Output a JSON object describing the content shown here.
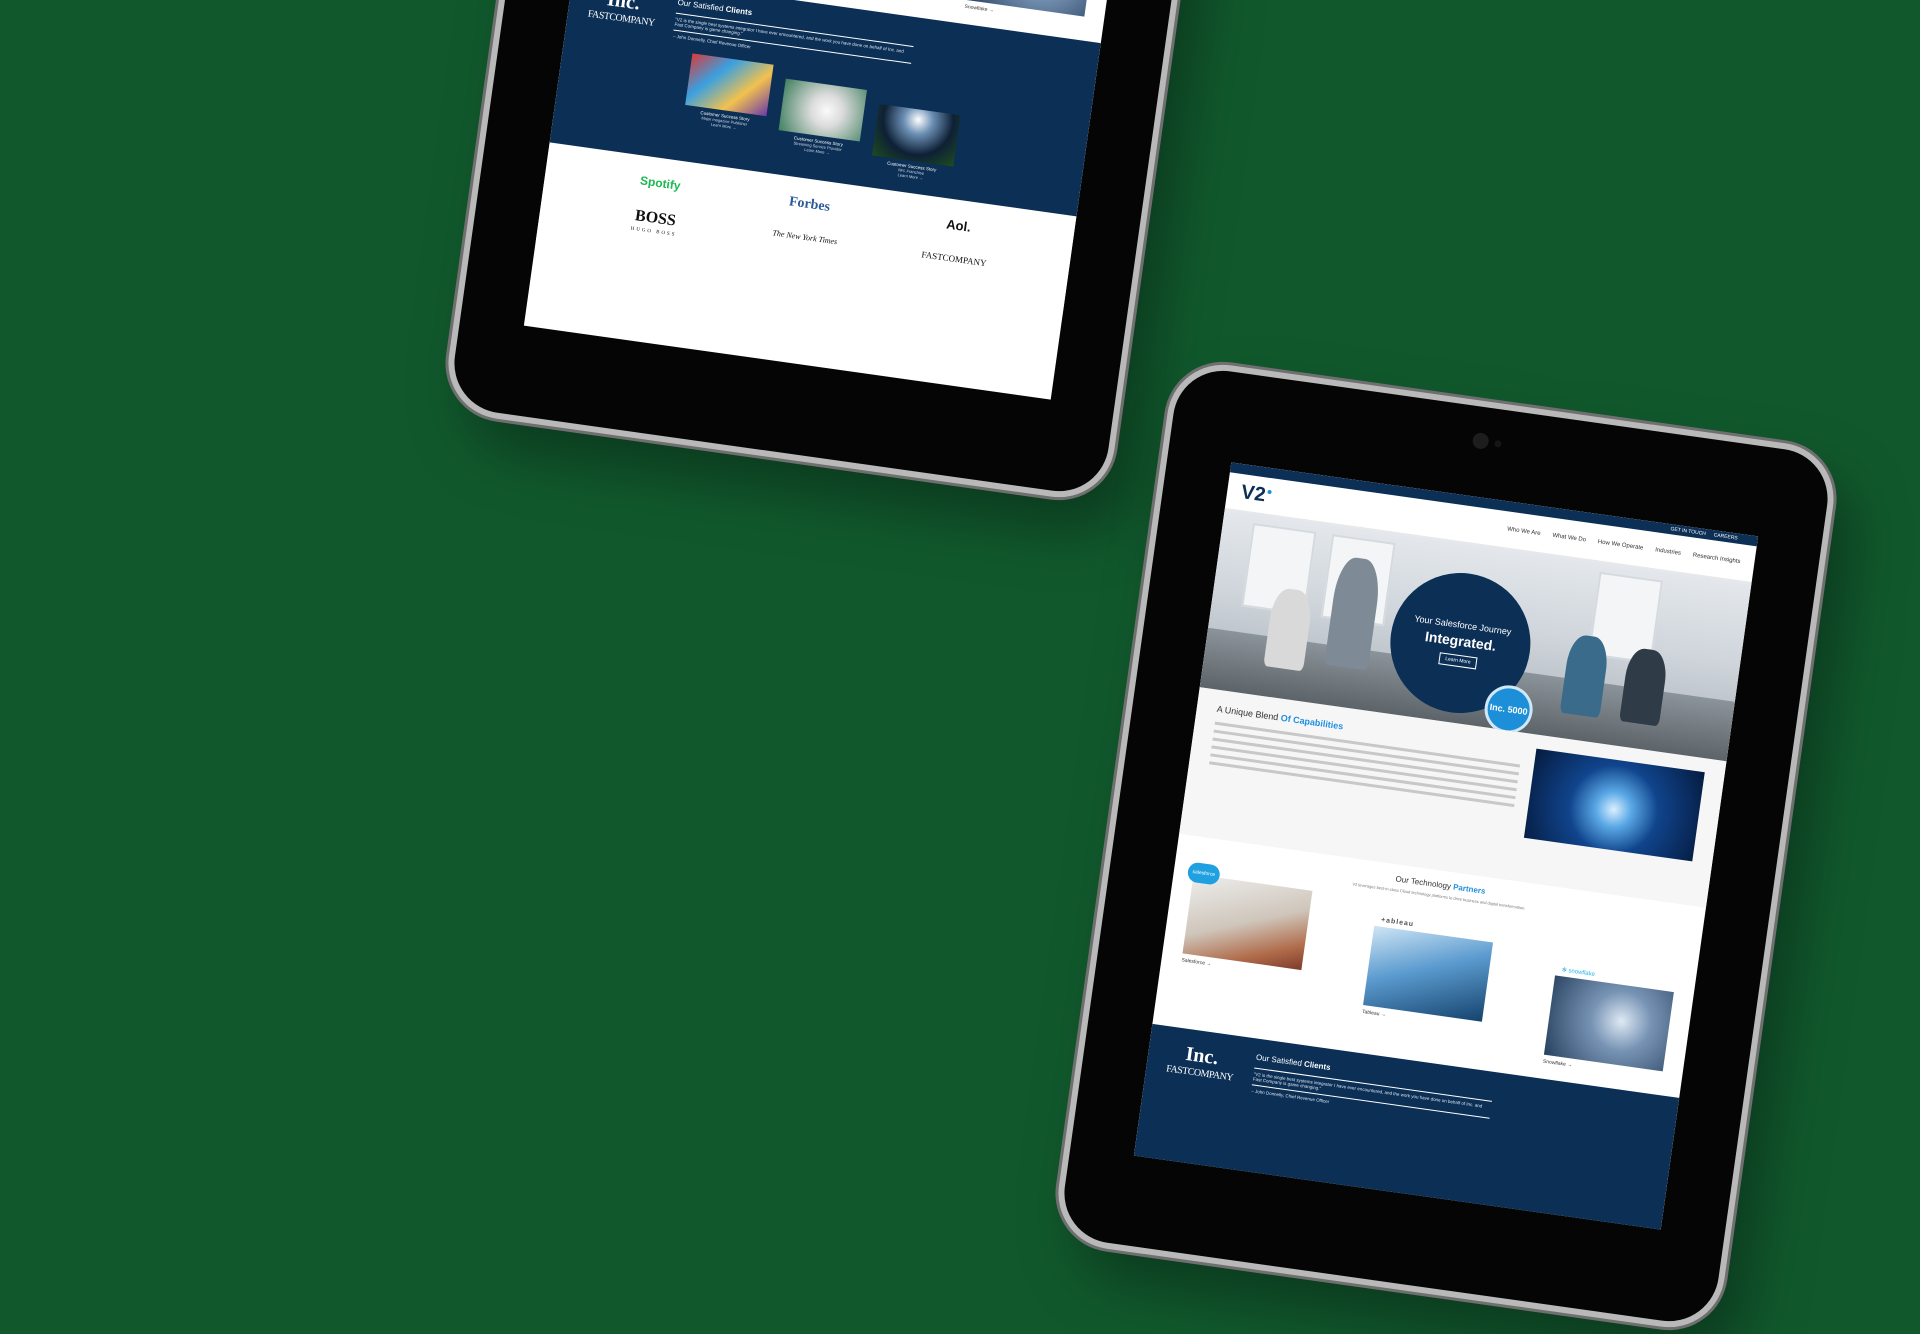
{
  "header": {
    "logo": "V2",
    "topbar_links": [
      "GET IN TOUCH",
      "CAREERS"
    ],
    "nav": [
      "Who We Are",
      "What We Do",
      "How We Operate",
      "Industries",
      "Research Insights"
    ]
  },
  "hero": {
    "line1": "Your Salesforce Journey",
    "line2": "Integrated.",
    "button": "Learn More",
    "badge": "Inc. 5000"
  },
  "blend": {
    "title_prefix": "A Unique Blend",
    "title_highlight": "Of Capabilities"
  },
  "partners": {
    "title_prefix": "Our Technology",
    "title_highlight": "Partners",
    "subtitle": "V2 leverages best-in-class Cloud technology platforms to drive business and digital transformation.",
    "items": [
      {
        "label": "Salesforce →",
        "logo": "salesforce"
      },
      {
        "label": "Tableau →",
        "logo": "tableau"
      },
      {
        "label": "Snowflake →",
        "logo": "snowflake"
      }
    ]
  },
  "clients": {
    "logo_inc": "Inc.",
    "logo_fc": "FASTCOMPANY",
    "title_prefix": "Our Satisfied",
    "title_highlight": "Clients",
    "quote": "\"V2 is the single best systems integrator I have ever encountered, and the work you have done on behalf of Inc. and Fast Company is game changing.\"",
    "attribution": "– John Donnelly, Chief Revenue Officer",
    "stories": [
      {
        "title": "Customer Success Story",
        "subtitle": "Major magazine Publisher",
        "more": "Learn More →"
      },
      {
        "title": "Customer Success Story",
        "subtitle": "Streaming Service Provider",
        "more": "Learn More →"
      },
      {
        "title": "Customer Success Story",
        "subtitle": "NFL Franchise",
        "more": "Learn More →"
      }
    ]
  },
  "brands": [
    "Spotify",
    "Forbes",
    "Aol.",
    "BOSS",
    "The New York Times",
    "FASTCOMPANY"
  ],
  "boss_sub": "HUGO BOSS"
}
